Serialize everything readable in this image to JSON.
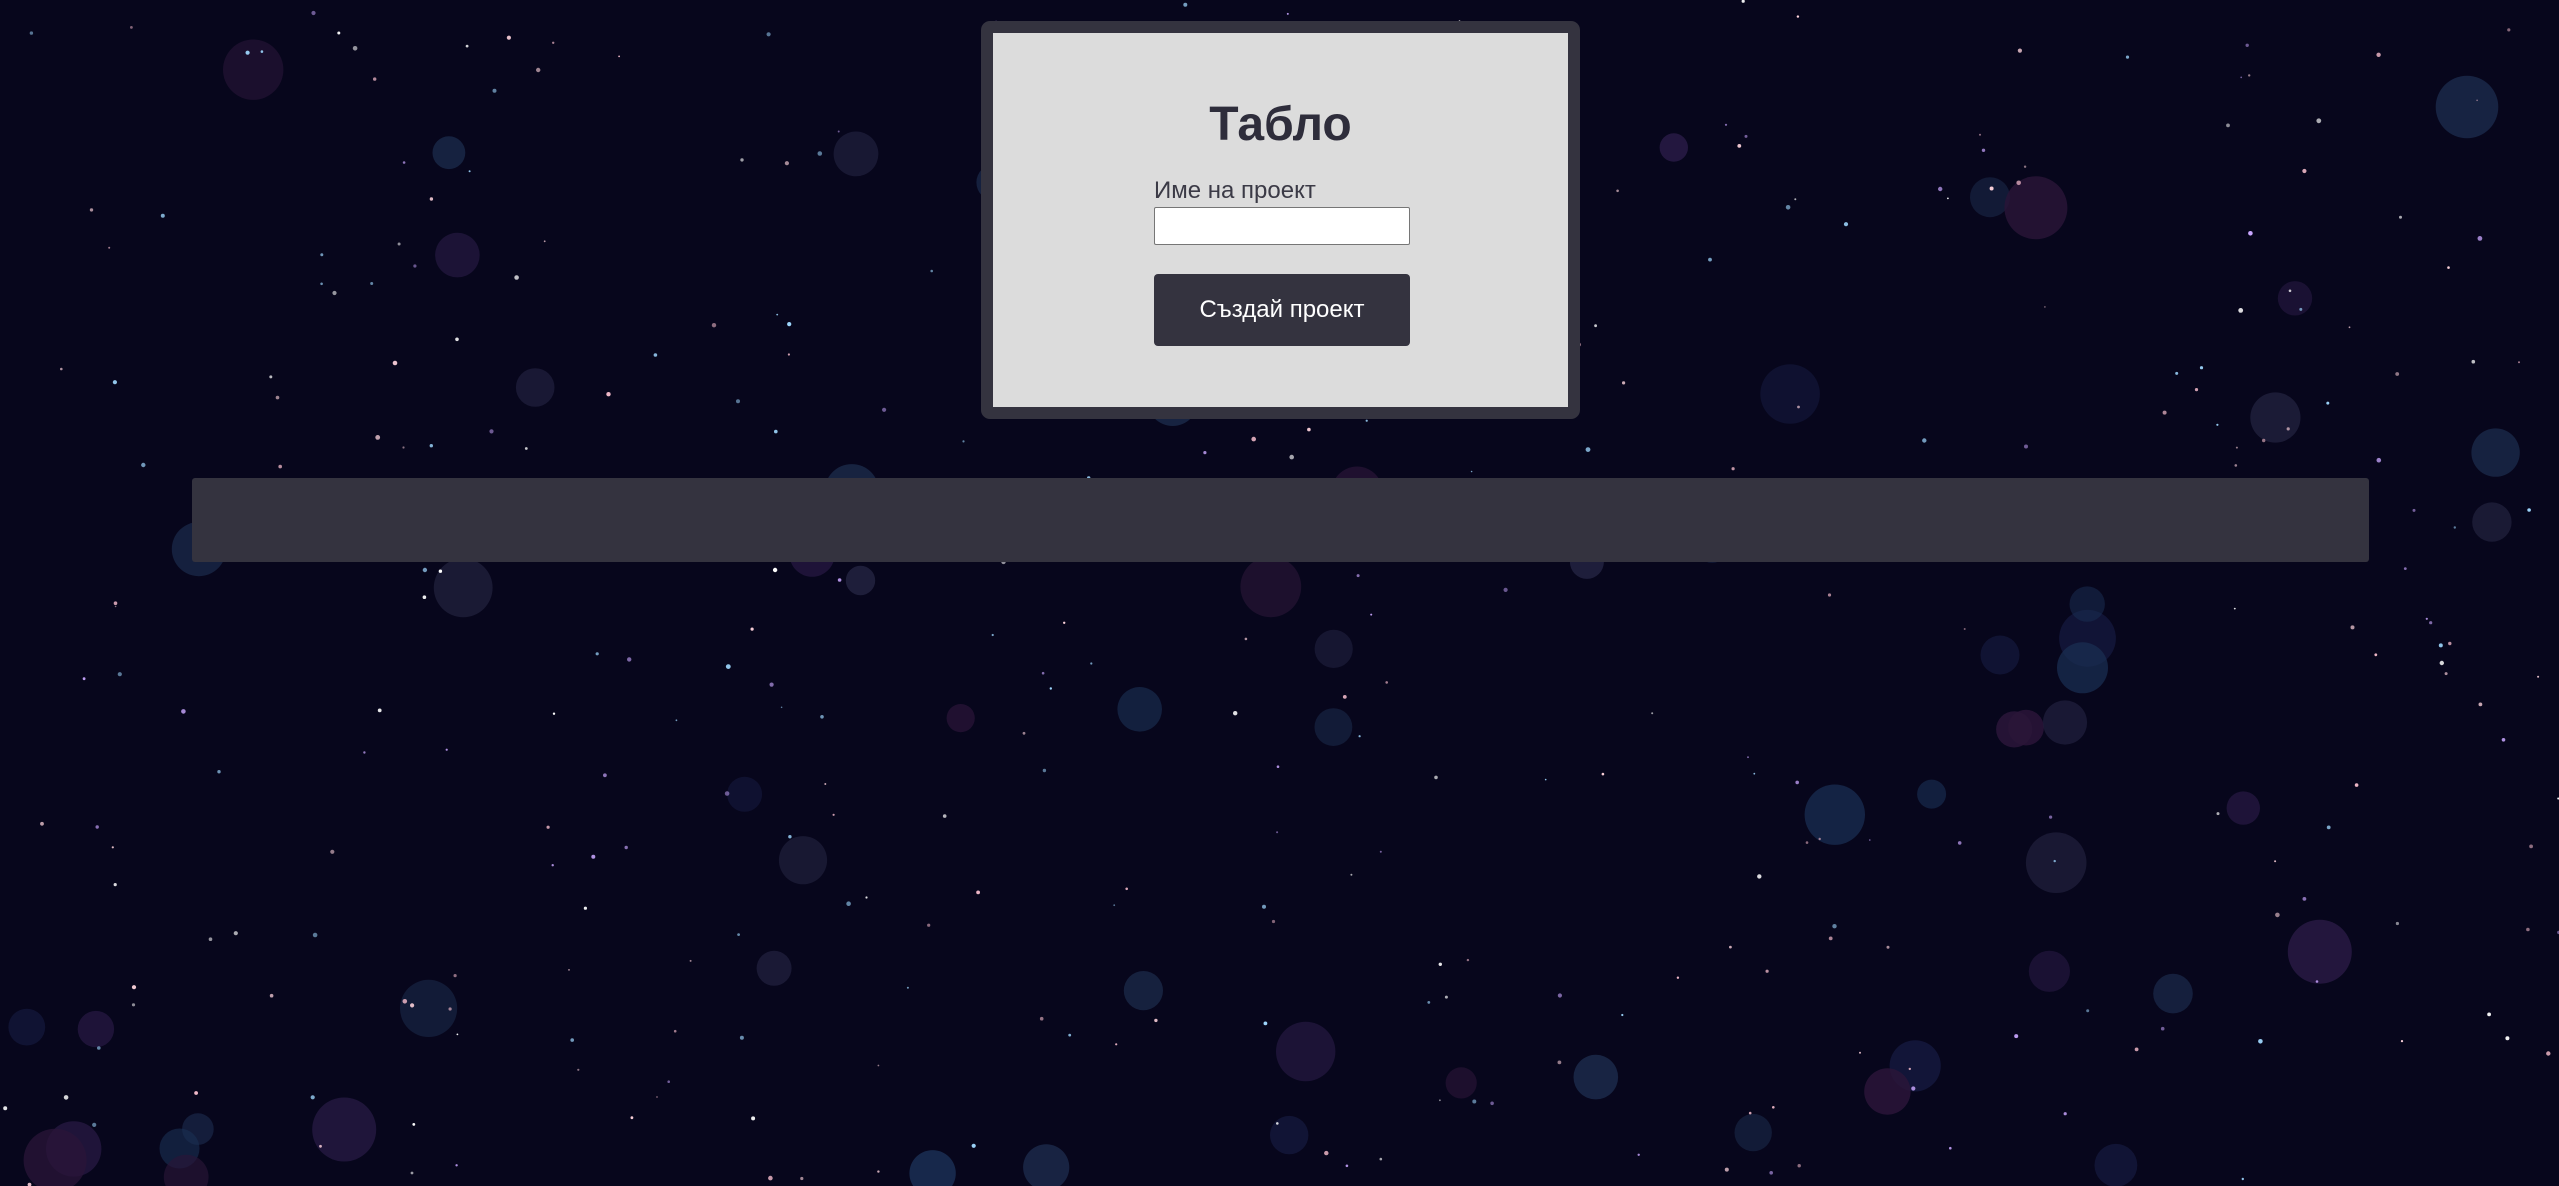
{
  "panel": {
    "title": "Табло",
    "project_name_label": "Име на проект",
    "project_name_value": "",
    "create_button_label": "Създай проект"
  },
  "colors": {
    "page_background": "#07061c",
    "panel_frame": "#34333f",
    "panel_background": "#dcdcdc",
    "button_background": "#34333f",
    "button_text": "#ffffff",
    "bar_background": "#34333f"
  }
}
